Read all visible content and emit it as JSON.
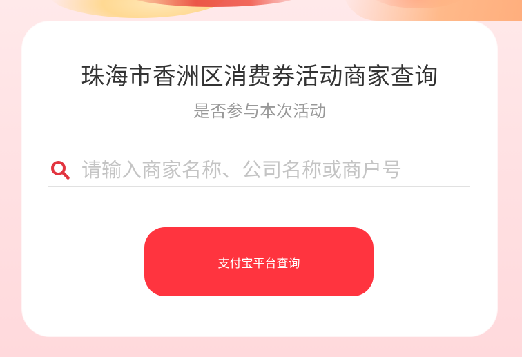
{
  "page": {
    "title": "珠海市香洲区消费券活动商家查询",
    "subtitle": "是否参与本次活动"
  },
  "search": {
    "placeholder": "请输入商家名称、公司名称或商户号",
    "value": "",
    "icon": "search-icon"
  },
  "actions": {
    "query_label": "支付宝平台查询"
  },
  "colors": {
    "accent": "#ff343f",
    "icon": "#e2343f",
    "title": "#333333",
    "subtitle": "#999999",
    "placeholder": "#c4c4c4"
  }
}
